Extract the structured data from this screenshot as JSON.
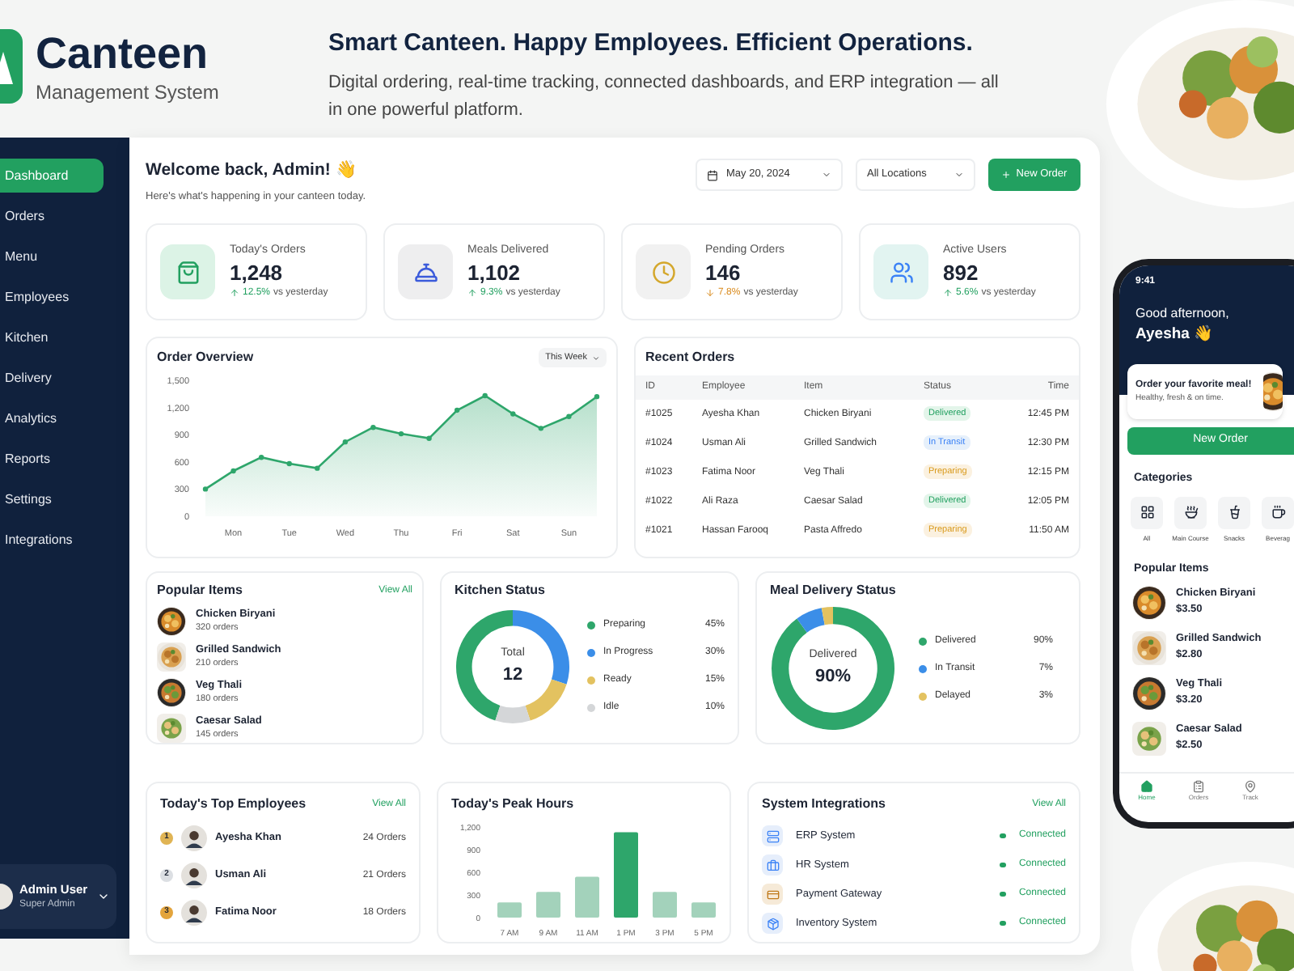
{
  "brand": {
    "name": "Canteen",
    "subtitle": "Management System"
  },
  "hero": {
    "headline": "Smart Canteen. Happy Employees. Efficient Operations.",
    "text": "Digital ordering, real-time tracking, connected dashboards, and ERP integration — all in one powerful platform."
  },
  "sidebar": {
    "items": [
      {
        "label": "Dashboard",
        "selected": true
      },
      {
        "label": "Orders",
        "selected": false
      },
      {
        "label": "Menu",
        "selected": false
      },
      {
        "label": "Employees",
        "selected": false
      },
      {
        "label": "Kitchen",
        "selected": false
      },
      {
        "label": "Delivery",
        "selected": false
      },
      {
        "label": "Analytics",
        "selected": false
      },
      {
        "label": "Reports",
        "selected": false
      },
      {
        "label": "Settings",
        "selected": false
      },
      {
        "label": "Integrations",
        "selected": false
      }
    ],
    "user": {
      "name": "Admin User",
      "role": "Super Admin"
    }
  },
  "dashboard": {
    "title": "Welcome back, Admin! 👋",
    "subtitle": "Here's what's happening in your canteen today.",
    "date": "May 20, 2024",
    "location": "All Locations",
    "new_order": "New Order",
    "stats": [
      {
        "kind": "bag",
        "label": "Today's Orders",
        "value": "1,248",
        "change": {
          "kind": "up",
          "value": "12.5%"
        },
        "note": "vs yesterday"
      },
      {
        "kind": "cloche",
        "label": "Meals Delivered",
        "value": "1,102",
        "change": {
          "kind": "up",
          "value": "9.3%"
        },
        "note": "vs yesterday"
      },
      {
        "kind": "clock",
        "label": "Pending Orders",
        "value": "146",
        "change": {
          "kind": "down",
          "value": "7.8%"
        },
        "note": "vs yesterday"
      },
      {
        "kind": "users",
        "label": "Active Users",
        "value": "892",
        "change": {
          "kind": "up",
          "value": "5.6%"
        },
        "note": "vs yesterday"
      }
    ],
    "order_overview": {
      "title": "Order Overview",
      "range": "This Week",
      "chart_data": {
        "type": "area",
        "categories": [
          null,
          "Mon",
          null,
          "Tue",
          null,
          "Wed",
          null,
          "Thu",
          null,
          "Fri",
          null,
          "Sat",
          null,
          "Sun",
          null
        ],
        "series": [
          {
            "color": "#2ea66b",
            "values": [
              300,
              500,
              650,
              580,
              530,
              820,
              980,
              910,
              860,
              1170,
              1330,
              1130,
              970,
              1100,
              1320
            ]
          }
        ],
        "ylim": [
          0,
          1500
        ],
        "yticks": [
          0,
          300,
          600,
          900,
          {
            "value": 1200,
            "label": "1,200"
          },
          {
            "value": 1500,
            "label": "1,500"
          }
        ]
      }
    },
    "recent_orders": {
      "title": "Recent Orders",
      "columns": [
        "ID",
        "Employee",
        "Item",
        "Status",
        "Time"
      ],
      "rows": [
        {
          "id": "#1025",
          "employee": "Ayesha Khan",
          "item": "Chicken Biryani",
          "status": "Delivered",
          "kind": "delivered",
          "time": "12:45 PM"
        },
        {
          "id": "#1024",
          "employee": "Usman Ali",
          "item": "Grilled Sandwich",
          "status": "In Transit",
          "kind": "transit",
          "time": "12:30 PM"
        },
        {
          "id": "#1023",
          "employee": "Fatima Noor",
          "item": "Veg Thali",
          "status": "Preparing",
          "kind": "preparing",
          "time": "12:15 PM"
        },
        {
          "id": "#1022",
          "employee": "Ali Raza",
          "item": "Caesar Salad",
          "status": "Delivered",
          "kind": "delivered",
          "time": "12:05 PM"
        },
        {
          "id": "#1021",
          "employee": "Hassan Farooq",
          "item": "Pasta Affredo",
          "status": "Preparing",
          "kind": "preparing",
          "time": "11:50 AM"
        }
      ]
    },
    "popular_items": {
      "title": "Popular Items",
      "link": "View All",
      "items": [
        {
          "name": "Chicken Biryani",
          "orders": "320 orders"
        },
        {
          "name": "Grilled Sandwich",
          "orders": "210 orders"
        },
        {
          "name": "Veg Thali",
          "orders": "180 orders"
        },
        {
          "name": "Caesar Salad",
          "orders": "145 orders"
        }
      ]
    },
    "kitchen_status": {
      "title": "Kitchen Status",
      "center_label": "Total",
      "center_value": "12",
      "legend": [
        {
          "color": "#2ea66b"
        },
        {
          "color": "#3b8ee8"
        },
        {
          "color": "#e3c260"
        },
        {
          "color": "#d4d6d8"
        }
      ],
      "chart_data": {
        "type": "donut",
        "categories": [
          "Preparing",
          "In Progress",
          "Ready",
          "Idle"
        ],
        "values": [
          45,
          30,
          15,
          10
        ],
        "value_labels": [
          "45%",
          "30%",
          "15%",
          "10%"
        ]
      }
    },
    "delivery_status": {
      "title": "Meal Delivery Status",
      "center_label": "Delivered",
      "center_value": "90%",
      "legend": [
        {
          "color": "#2ea66b"
        },
        {
          "color": "#3b8ee8"
        },
        {
          "color": "#e3c260"
        }
      ],
      "chart_data": {
        "type": "donut",
        "categories": [
          "Delivered",
          "In Transit",
          "Delayed"
        ],
        "values": [
          90,
          7,
          3
        ],
        "value_labels": [
          "90%",
          "7%",
          "3%"
        ]
      }
    },
    "top_employees": {
      "title": "Today's Top Employees",
      "link": "View All",
      "items": [
        {
          "rank": "1",
          "name": "Ayesha Khan",
          "orders": "24 Orders",
          "color": "#e0b454"
        },
        {
          "rank": "2",
          "name": "Usman Ali",
          "orders": "21 Orders",
          "color": "#dcdfe3"
        },
        {
          "rank": "3",
          "name": "Fatima Noor",
          "orders": "18 Orders",
          "color": "#e3a43c"
        }
      ]
    },
    "peak_hours": {
      "title": "Today's Peak Hours",
      "chart_data": {
        "type": "bar",
        "categories": [
          "7 AM",
          "9 AM",
          "11 AM",
          "1 PM",
          "3 PM",
          "5 PM"
        ],
        "series": [
          {
            "color": "#a3d2bb",
            "values": [
              200,
              340,
              540,
              null,
              340,
              200
            ]
          },
          {
            "color": "#2ea66b",
            "values": [
              null,
              null,
              null,
              1130,
              null,
              null
            ]
          }
        ],
        "stacked": true,
        "ylim": [
          0,
          1200
        ],
        "yticks": [
          0,
          300,
          600,
          900,
          {
            "value": 1200,
            "label": "1,200"
          }
        ]
      }
    },
    "integrations": {
      "title": "System Integrations",
      "link": "View All",
      "items": [
        {
          "kind": "erp",
          "name": "ERP System",
          "status": "Connected"
        },
        {
          "kind": "hr",
          "name": "HR System",
          "status": "Connected"
        },
        {
          "kind": "payment",
          "name": "Payment Gateway",
          "status": "Connected"
        },
        {
          "kind": "inventory",
          "name": "Inventory System",
          "status": "Connected"
        }
      ]
    }
  },
  "phone": {
    "time": "9:41",
    "greeting": "Good afternoon,",
    "name": "Ayesha 👋",
    "promo_title": "Order your favorite meal!",
    "promo_text": "Healthy, fresh & on time.",
    "button": "New Order",
    "categories_title": "Categories",
    "categories": [
      {
        "kind": "all",
        "label": "All"
      },
      {
        "kind": "main",
        "label": "Main Course"
      },
      {
        "kind": "snacks",
        "label": "Snacks"
      },
      {
        "kind": "beverage",
        "label": "Beverag"
      }
    ],
    "popular_title": "Popular Items",
    "items": [
      {
        "name": "Chicken Biryani",
        "price": "$3.50"
      },
      {
        "name": "Grilled Sandwich",
        "price": "$2.80"
      },
      {
        "name": "Veg Thali",
        "price": "$3.20"
      },
      {
        "name": "Caesar Salad",
        "price": "$2.50"
      }
    ],
    "nav": [
      {
        "kind": "home",
        "label": "Home",
        "selected": true
      },
      {
        "kind": "orders",
        "label": "Orders",
        "selected": false
      },
      {
        "kind": "track",
        "label": "Track",
        "selected": false
      }
    ]
  }
}
